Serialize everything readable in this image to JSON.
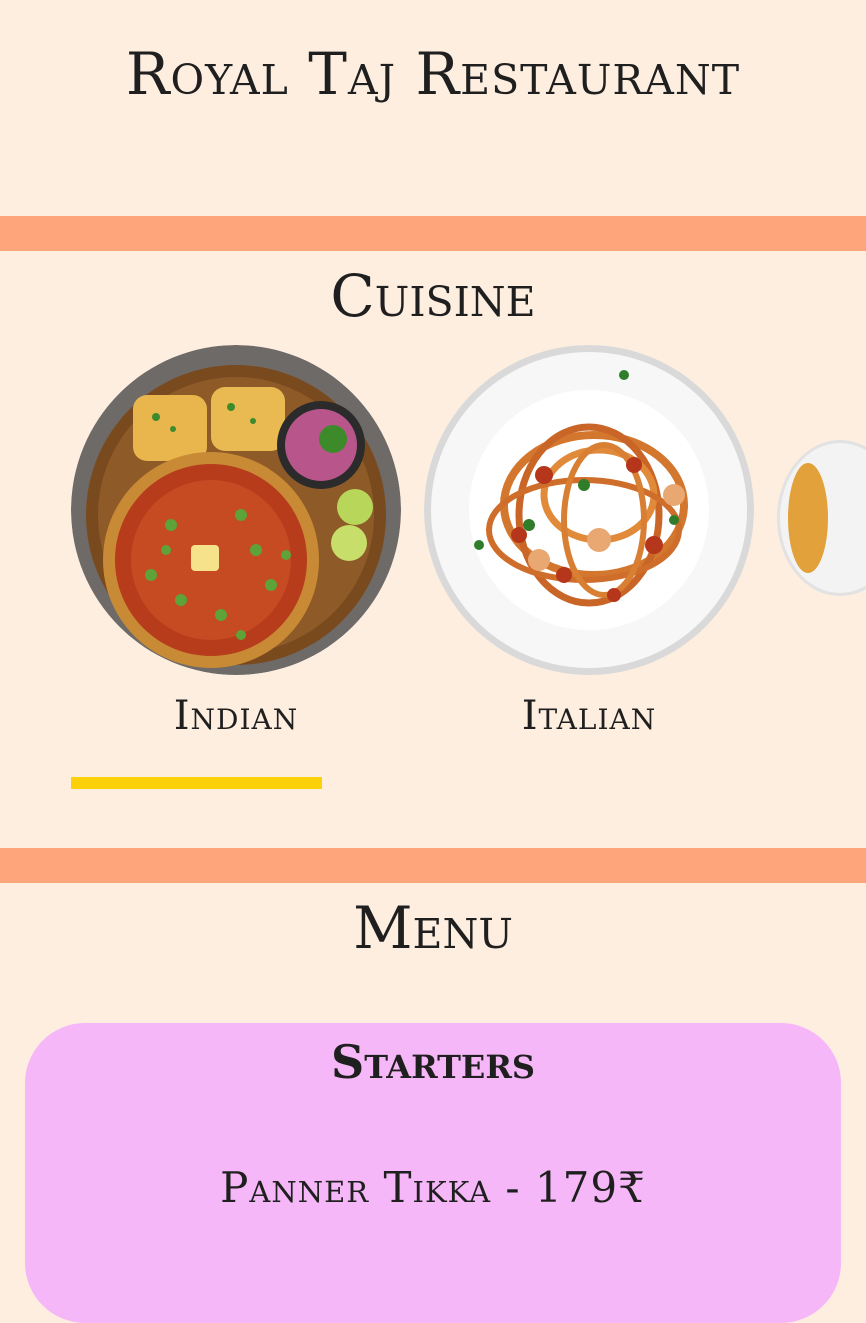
{
  "header": {
    "title": "Royal Taj Restaurant"
  },
  "cuisine": {
    "heading": "Cuisine",
    "items": [
      {
        "label": "Indian",
        "active": true
      },
      {
        "label": "Italian",
        "active": false
      }
    ]
  },
  "menu": {
    "heading": "Menu",
    "categories": [
      {
        "title": "Starters",
        "items": [
          {
            "text": "Panner Tikka - 179₹"
          }
        ]
      }
    ]
  },
  "colors": {
    "background": "#fdeee0",
    "band": "#fea57c",
    "active_underline": "#fcd10a",
    "menu_card": "#f6b7f8"
  }
}
